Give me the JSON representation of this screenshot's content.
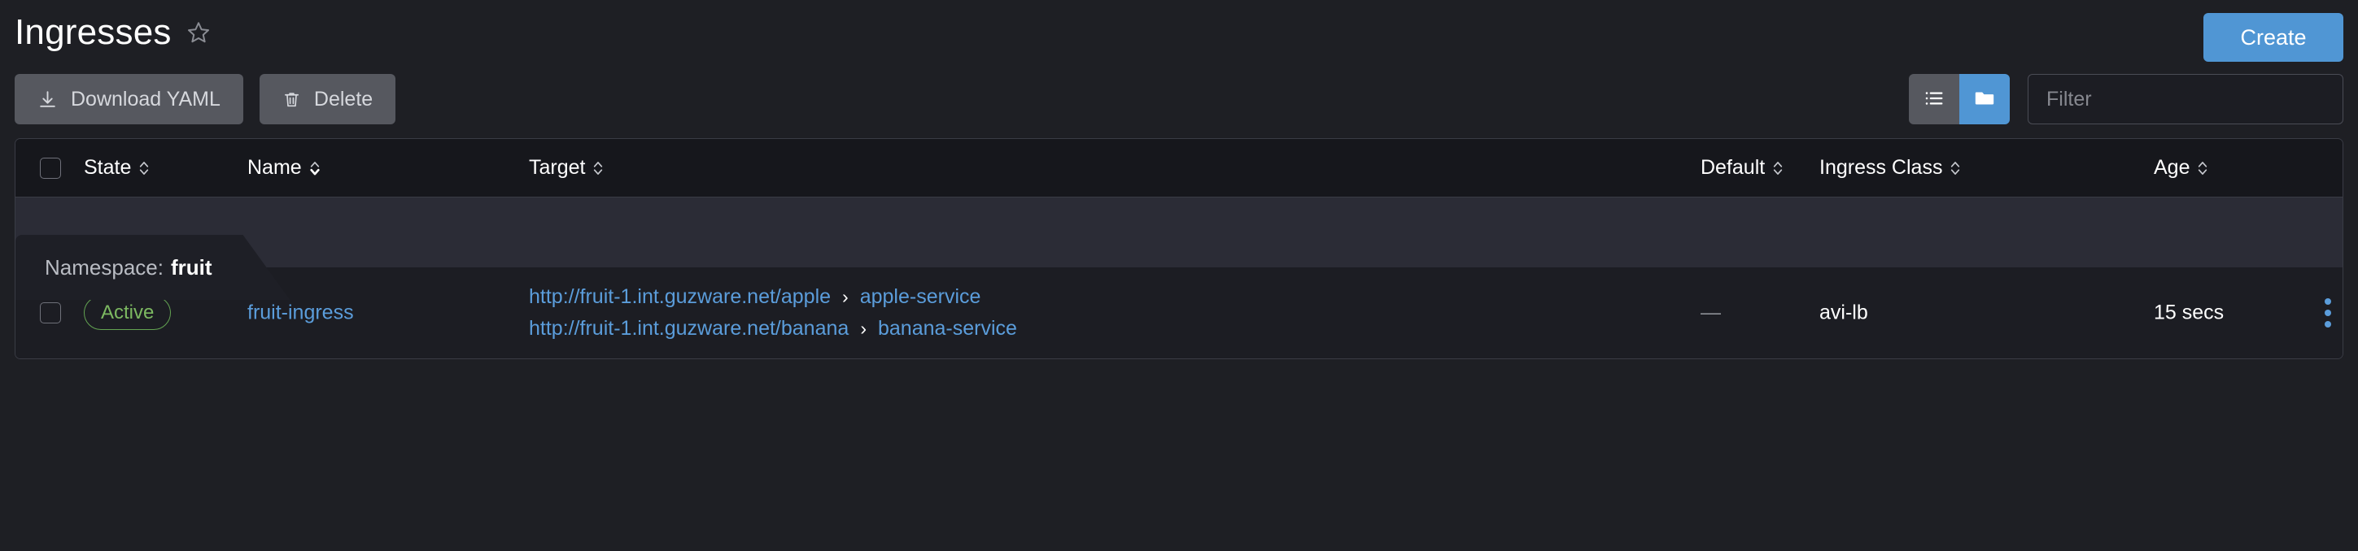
{
  "header": {
    "title": "Ingresses",
    "favorite_icon": "star-outline-icon",
    "create_label": "Create"
  },
  "toolbar": {
    "download_yaml_label": "Download YAML",
    "download_icon": "download-icon",
    "delete_label": "Delete",
    "delete_icon": "trash-icon",
    "view_toggle": {
      "list_icon": "list-view-icon",
      "group_icon": "folder-group-icon",
      "active": "group"
    },
    "filter_placeholder": "Filter",
    "filter_value": ""
  },
  "table": {
    "select_all_checkbox": false,
    "columns": [
      {
        "key": "state",
        "label": "State",
        "sorted": "none"
      },
      {
        "key": "name",
        "label": "Name",
        "sorted": "asc"
      },
      {
        "key": "target",
        "label": "Target",
        "sorted": "none"
      },
      {
        "key": "default",
        "label": "Default",
        "sorted": "none"
      },
      {
        "key": "class",
        "label": "Ingress Class",
        "sorted": "none"
      },
      {
        "key": "age",
        "label": "Age",
        "sorted": "none"
      }
    ],
    "group": {
      "label": "Namespace:",
      "value": "fruit"
    },
    "rows": [
      {
        "checked": false,
        "state": "Active",
        "name": "fruit-ingress",
        "targets": [
          {
            "url": "http://fruit-1.int.guzware.net/apple",
            "separator": "›",
            "service": "apple-service"
          },
          {
            "url": "http://fruit-1.int.guzware.net/banana",
            "separator": "›",
            "service": "banana-service"
          }
        ],
        "default": "—",
        "ingress_class": "avi-lb",
        "age": "15 secs",
        "actions_icon": "kebab-menu-icon"
      }
    ]
  },
  "colors": {
    "page_background": "#1e1f24",
    "accent_blue": "#5096d4",
    "link_blue": "#5b9ddb",
    "state_green": "#7cb861",
    "header_background": "#16171c",
    "group_band": "#2b2c36",
    "row_background": "#1c1d23",
    "border": "#3a3c45"
  }
}
